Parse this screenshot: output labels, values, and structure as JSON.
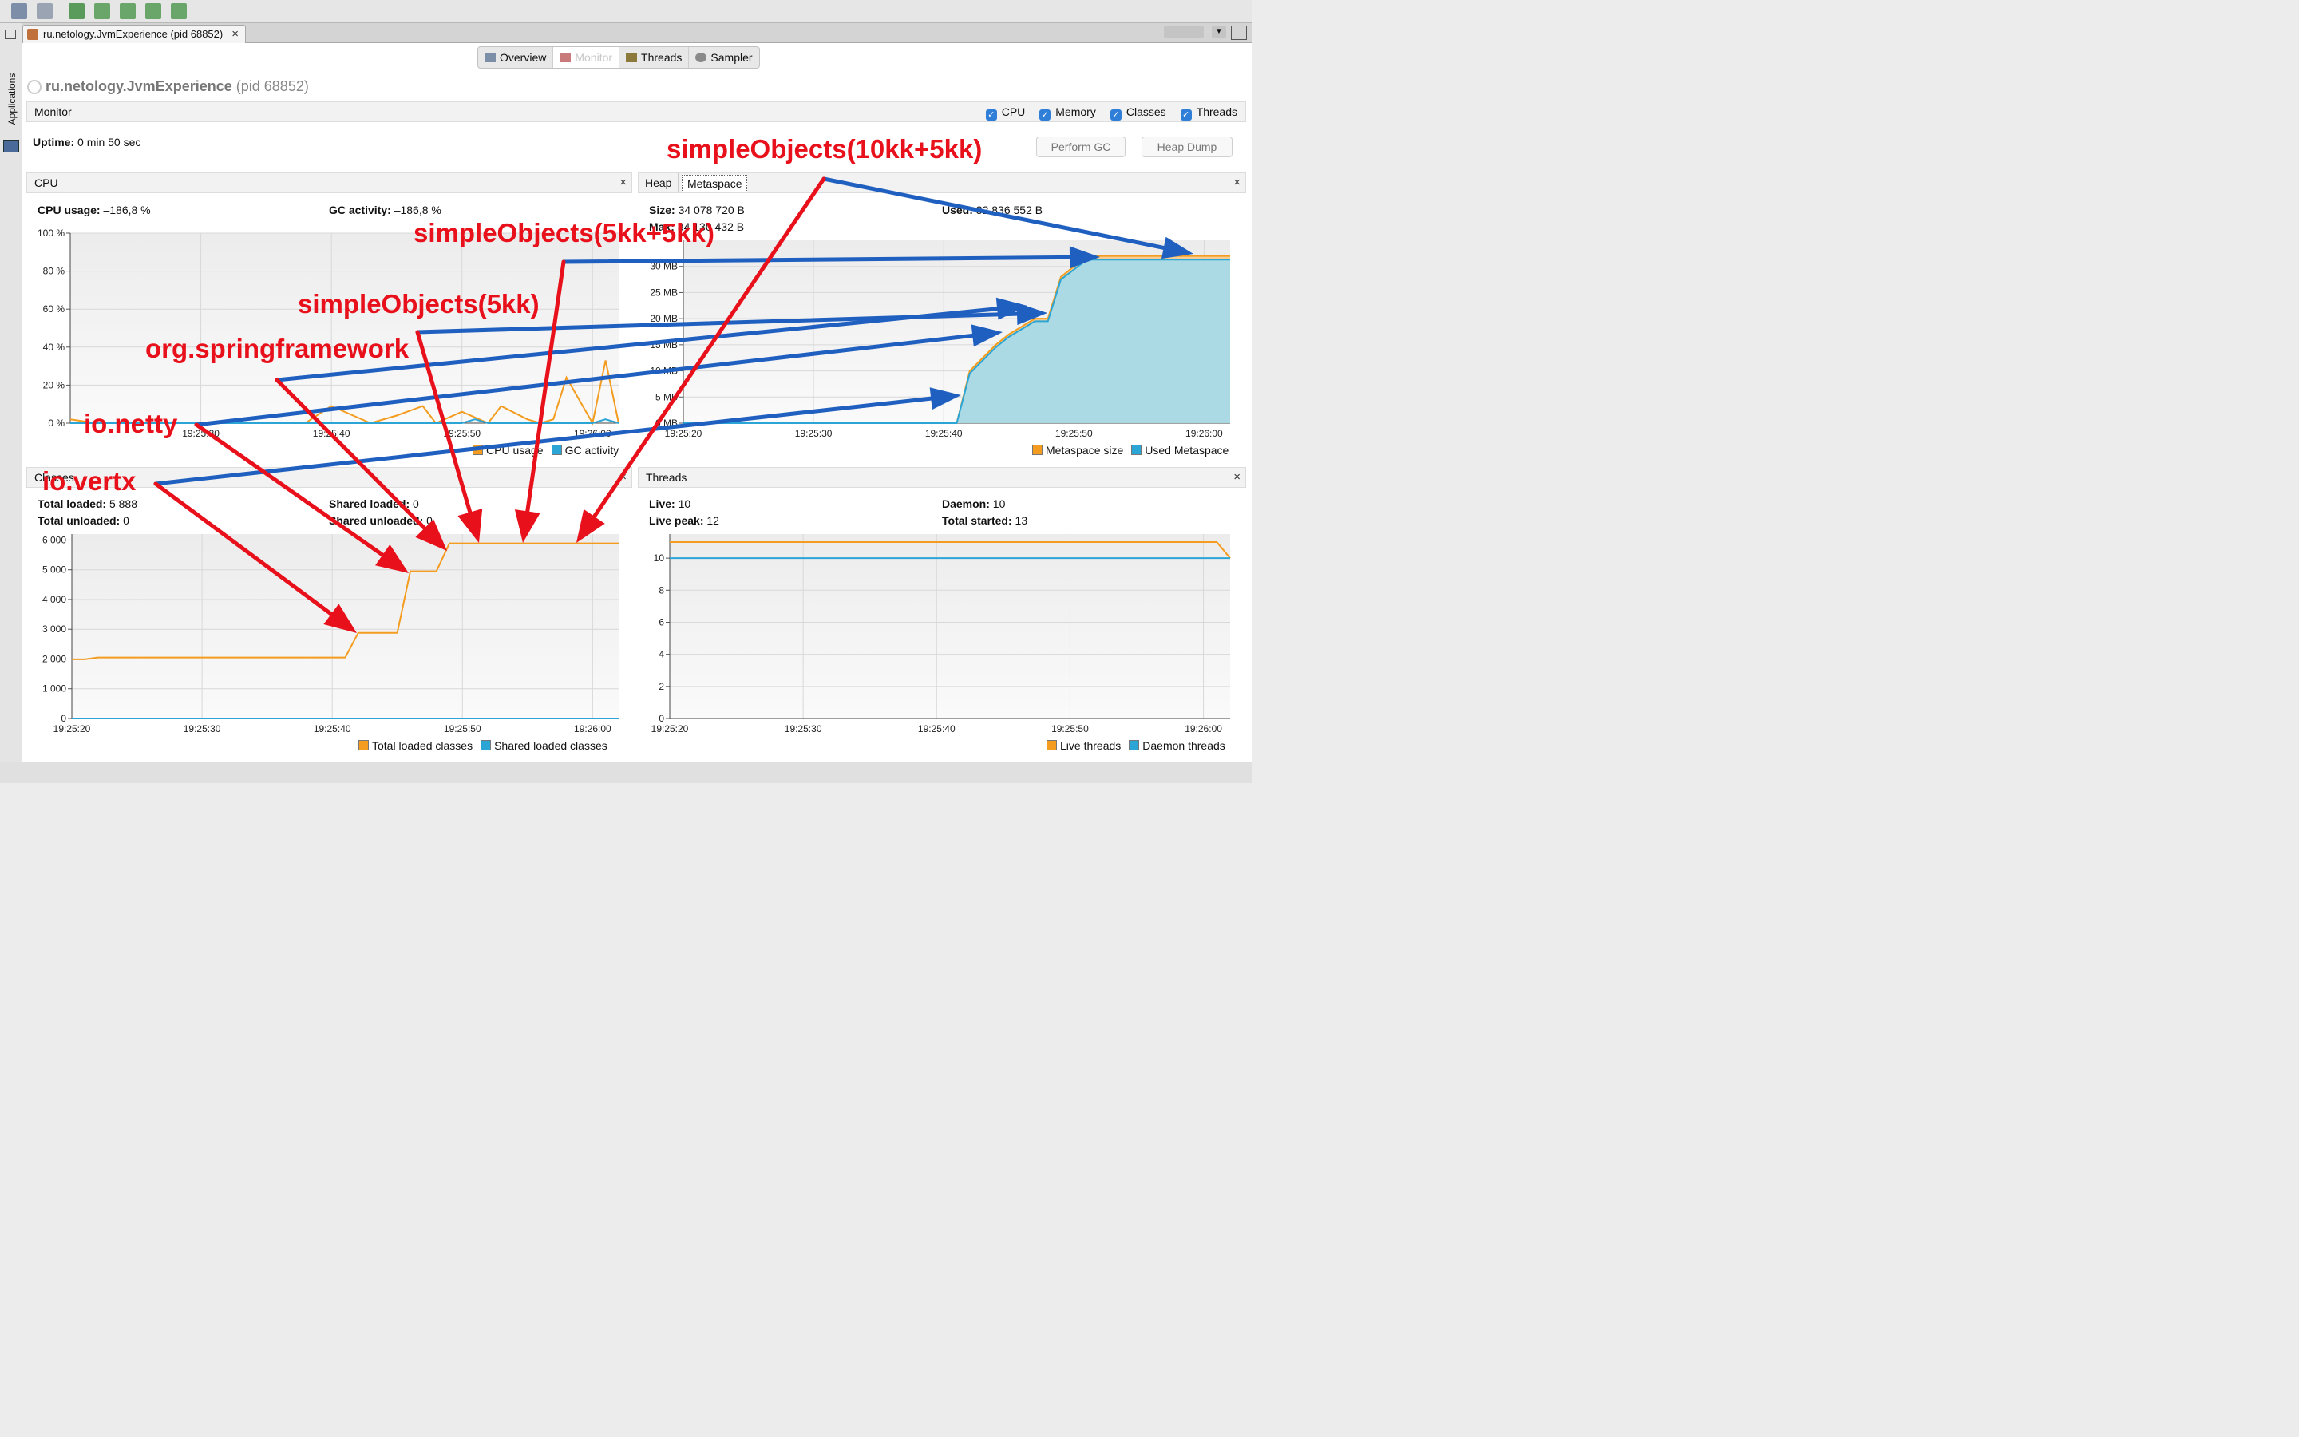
{
  "window": {
    "doc_tab_title": "ru.netology.JvmExperience (pid 68852)",
    "side_label": "Applications"
  },
  "subtabs": [
    "Overview",
    "Monitor",
    "Threads",
    "Sampler"
  ],
  "app_header": {
    "name": "ru.netology.JvmExperience",
    "pid": "(pid 68852)"
  },
  "monitor": {
    "title": "Monitor",
    "checkboxes": [
      "CPU",
      "Memory",
      "Classes",
      "Threads"
    ],
    "uptime_label": "Uptime:",
    "uptime_value": "0 min 50 sec",
    "perform_gc": "Perform GC",
    "heap_dump": "Heap Dump"
  },
  "cpu_panel": {
    "title": "CPU",
    "cpu_usage_label": "CPU usage:",
    "cpu_usage_value": "–186,8 %",
    "gc_label": "GC activity:",
    "gc_value": "–186,8 %",
    "legend": [
      "CPU usage",
      "GC activity"
    ]
  },
  "heap_panel": {
    "tabs": [
      "Heap",
      "Metaspace"
    ],
    "size_label": "Size:",
    "size_value": "34 078 720 B",
    "used_label": "Used:",
    "used_value": "32 836 552 B",
    "max_label": "Max:",
    "max_value": "34 130 432 B",
    "legend": [
      "Metaspace size",
      "Used Metaspace"
    ]
  },
  "classes_panel": {
    "title": "Classes",
    "total_loaded_label": "Total loaded:",
    "total_loaded_value": "5 888",
    "total_unloaded_label": "Total unloaded:",
    "total_unloaded_value": "0",
    "shared_loaded_label": "Shared loaded:",
    "shared_loaded_value": "0",
    "shared_unloaded_label": "Shared unloaded:",
    "shared_unloaded_value": "0",
    "legend": [
      "Total loaded classes",
      "Shared loaded classes"
    ]
  },
  "threads_panel": {
    "title": "Threads",
    "live_label": "Live:",
    "live_value": "10",
    "live_peak_label": "Live peak:",
    "live_peak_value": "12",
    "daemon_label": "Daemon:",
    "daemon_value": "10",
    "total_started_label": "Total started:",
    "total_started_value": "13",
    "legend": [
      "Live threads",
      "Daemon threads"
    ]
  },
  "annotations": [
    "simpleObjects(10kk+5kk)",
    "simpleObjects(5kk+5kk)",
    "simpleObjects(5kk)",
    "org.springframework",
    "io.netty",
    "io.vertx"
  ],
  "colors": {
    "orange": "#f39c1f",
    "blue": "#2aa5d6",
    "annotation_red": "#e8101a",
    "arrow_blue": "#1f5fbf",
    "checkbox": "#2f7fd8"
  },
  "chart_data": [
    {
      "type": "line",
      "title": "CPU",
      "x_ticks": [
        "19:25:30",
        "19:25:40",
        "19:25:50",
        "19:26:00"
      ],
      "y_ticks": [
        "0 %",
        "20 %",
        "40 %",
        "60 %",
        "80 %",
        "100 %"
      ],
      "ylim": [
        0,
        100
      ],
      "series": [
        {
          "name": "CPU usage",
          "x": [
            "19:25:20",
            "19:25:22",
            "19:25:35",
            "19:25:38",
            "19:25:40",
            "19:25:43",
            "19:25:45",
            "19:25:47",
            "19:25:48",
            "19:25:50",
            "19:25:52",
            "19:25:53",
            "19:25:55",
            "19:25:56",
            "19:25:57",
            "19:25:58",
            "19:26:00",
            "19:26:01",
            "19:26:02"
          ],
          "values": [
            2,
            0,
            0,
            0,
            9,
            0,
            4,
            9,
            0,
            6,
            0,
            9,
            2,
            0,
            2,
            24,
            0,
            33,
            0
          ]
        },
        {
          "name": "GC activity",
          "x": [
            "19:25:20",
            "19:25:50",
            "19:25:51",
            "19:25:52",
            "19:26:00",
            "19:26:01",
            "19:26:02"
          ],
          "values": [
            0,
            0,
            2,
            0,
            0,
            2,
            0
          ]
        }
      ]
    },
    {
      "type": "area",
      "title": "Metaspace",
      "x_ticks": [
        "19:25:20",
        "19:25:30",
        "19:25:40",
        "19:25:50",
        "19:26:00"
      ],
      "y_ticks": [
        "0 MB",
        "5 MB",
        "10 MB",
        "15 MB",
        "20 MB",
        "25 MB",
        "30 MB"
      ],
      "ylim": [
        0,
        35
      ],
      "series": [
        {
          "name": "Metaspace size",
          "x": [
            "19:25:20",
            "19:25:41",
            "19:25:42",
            "19:25:44",
            "19:25:45",
            "19:25:47",
            "19:25:48",
            "19:25:49",
            "19:25:51",
            "19:26:02"
          ],
          "values": [
            0,
            0,
            10,
            15,
            17,
            20,
            20,
            28,
            32,
            32
          ]
        },
        {
          "name": "Used Metaspace",
          "x": [
            "19:25:20",
            "19:25:41",
            "19:25:42",
            "19:25:44",
            "19:25:45",
            "19:25:47",
            "19:25:48",
            "19:25:49",
            "19:25:51",
            "19:26:02"
          ],
          "values": [
            0,
            0,
            9.5,
            14.5,
            16.5,
            19.5,
            19.5,
            27.5,
            31.3,
            31.3
          ]
        }
      ]
    },
    {
      "type": "line",
      "title": "Classes",
      "x_ticks": [
        "19:25:20",
        "19:25:30",
        "19:25:40",
        "19:25:50",
        "19:26:00"
      ],
      "y_ticks": [
        "0",
        "1 000",
        "2 000",
        "3 000",
        "4 000",
        "5 000",
        "6 000"
      ],
      "ylim": [
        0,
        6200
      ],
      "series": [
        {
          "name": "Total loaded classes",
          "x": [
            "19:25:20",
            "19:25:21",
            "19:25:22",
            "19:25:41",
            "19:25:42",
            "19:25:45",
            "19:25:46",
            "19:25:48",
            "19:25:49",
            "19:26:02"
          ],
          "values": [
            1990,
            1990,
            2050,
            2050,
            2880,
            2880,
            4950,
            4950,
            5888,
            5888
          ]
        },
        {
          "name": "Shared loaded classes",
          "x": [
            "19:25:20",
            "19:26:02"
          ],
          "values": [
            0,
            0
          ]
        }
      ]
    },
    {
      "type": "line",
      "title": "Threads",
      "x_ticks": [
        "19:25:20",
        "19:25:30",
        "19:25:40",
        "19:25:50",
        "19:26:00"
      ],
      "y_ticks": [
        "0",
        "2",
        "4",
        "6",
        "8",
        "10"
      ],
      "ylim": [
        0,
        11.5
      ],
      "series": [
        {
          "name": "Live threads",
          "x": [
            "19:25:20",
            "19:26:01",
            "19:26:02"
          ],
          "values": [
            11,
            11,
            10
          ]
        },
        {
          "name": "Daemon threads",
          "x": [
            "19:25:20",
            "19:26:02"
          ],
          "values": [
            10,
            10
          ]
        }
      ]
    }
  ]
}
